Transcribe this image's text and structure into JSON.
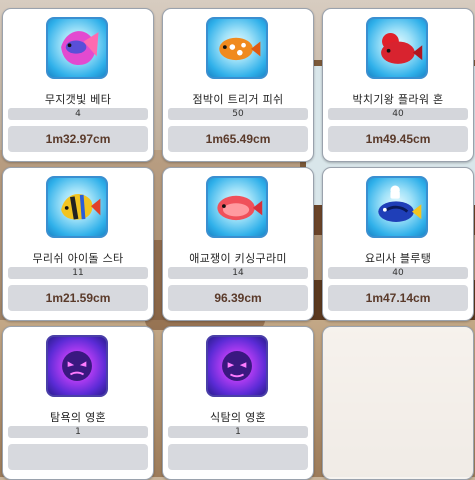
{
  "items": [
    {
      "name": "무지갯빛 베타",
      "count": "4",
      "size": "1m32.97cm",
      "icon": "rainbow-betta-fish-icon"
    },
    {
      "name": "점박이 트리거 피쉬",
      "count": "50",
      "size": "1m65.49cm",
      "icon": "spotted-triggerfish-icon"
    },
    {
      "name": "박치기왕 플라워 혼",
      "count": "40",
      "size": "1m49.45cm",
      "icon": "flowerhorn-fish-icon"
    },
    {
      "name": "무리쉬 아이돌 스타",
      "count": "11",
      "size": "1m21.59cm",
      "icon": "moorish-idol-fish-icon"
    },
    {
      "name": "애교쟁이 키싱구라미",
      "count": "14",
      "size": "96.39cm",
      "icon": "kissing-gourami-fish-icon"
    },
    {
      "name": "요리사 블루탱",
      "count": "40",
      "size": "1m47.14cm",
      "icon": "chef-blue-tang-fish-icon"
    },
    {
      "name": "탐욕의 영혼",
      "count": "1",
      "size": "",
      "icon": "greed-soul-icon"
    },
    {
      "name": "식탐의 영혼",
      "count": "1",
      "size": "",
      "icon": "gluttony-soul-icon"
    }
  ]
}
